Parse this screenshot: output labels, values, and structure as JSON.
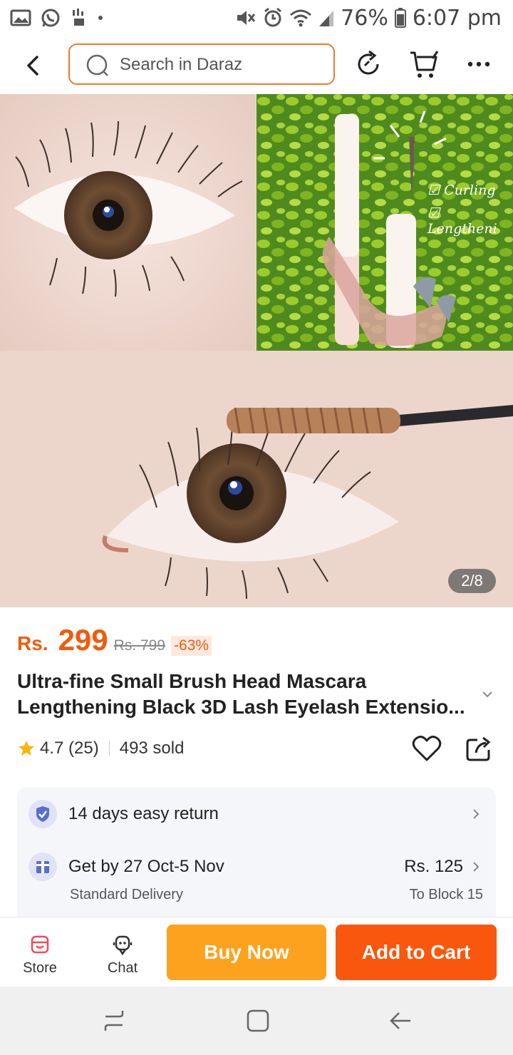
{
  "status_bar": {
    "battery": "76%",
    "time": "6:07 pm"
  },
  "header": {
    "search_placeholder": "Search in Daraz"
  },
  "gallery": {
    "counter": "2/8",
    "overlay_labels": [
      "☑ Curling",
      "☑ Lengtheni"
    ]
  },
  "product": {
    "currency": "Rs.",
    "price": "299",
    "old_price": "Rs. 799",
    "discount": "-63%",
    "title_line1": "Ultra-fine Small Brush Head Mascara",
    "title_line2": "Lengthening Black 3D Lash Eyelash Extensio...",
    "rating": "4.7 (25)",
    "sold": "493 sold"
  },
  "info": {
    "return_label": "14 days easy return",
    "delivery_label": "Get by 27 Oct-5 Nov",
    "delivery_type": "Standard Delivery",
    "delivery_price": "Rs. 125",
    "delivery_to": "To Block 15"
  },
  "actions": {
    "store_label": "Store",
    "chat_label": "Chat",
    "buy_now_label": "Buy Now",
    "add_to_cart_label": "Add to Cart"
  },
  "colors": {
    "brand_orange": "#f25a0c",
    "buy_now": "#fca21e",
    "add_to_cart": "#f8570d"
  }
}
